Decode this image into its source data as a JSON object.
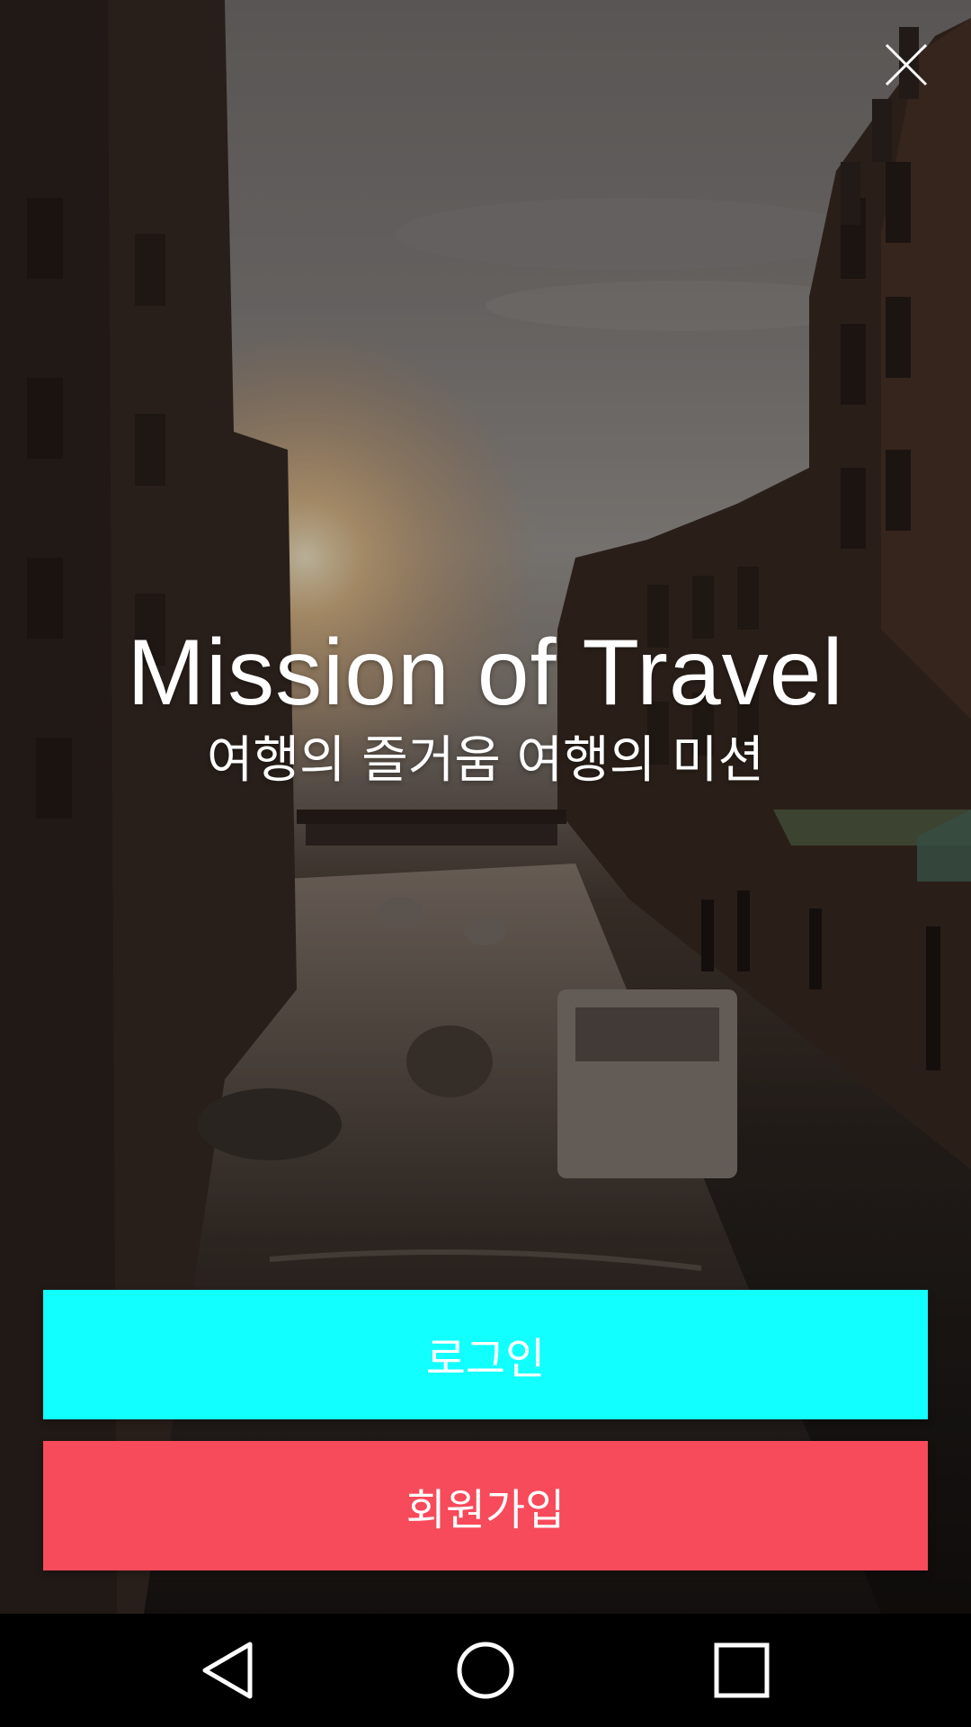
{
  "header": {
    "close_icon": "close-icon"
  },
  "hero": {
    "title": "Mission of Travel",
    "subtitle": "여행의 즐거움 여행의 미션"
  },
  "actions": {
    "login_label": "로그인",
    "signup_label": "회원가입",
    "login_color": "#12ffff",
    "signup_color": "#f74a5a"
  },
  "system_nav": {
    "back_icon": "back-icon",
    "home_icon": "home-icon",
    "recent_icon": "recent-apps-icon"
  }
}
